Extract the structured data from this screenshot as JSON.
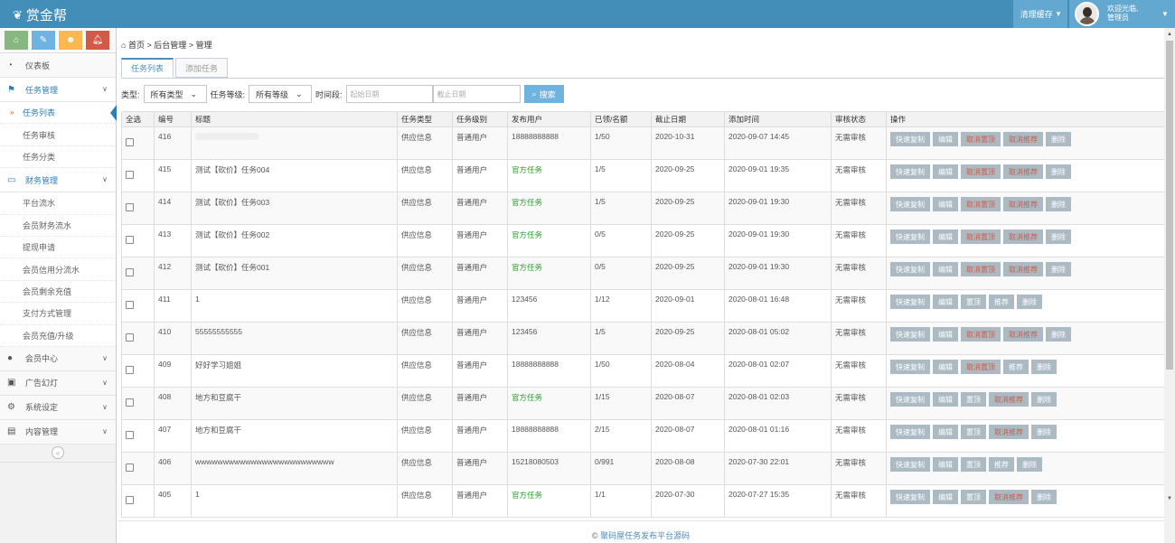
{
  "brand": {
    "name": "赏金帮",
    "icon": "leaf-icon"
  },
  "header": {
    "clear_cache": "清理缓存",
    "welcome_line1": "欢迎光临,",
    "welcome_line2": "管理员"
  },
  "shortcuts": [
    {
      "icon": "home-icon",
      "color": "#87b87f"
    },
    {
      "icon": "pencil-icon",
      "color": "#6fb3e0"
    },
    {
      "icon": "users-icon",
      "color": "#ffb752"
    },
    {
      "icon": "bell-icon",
      "color": "#d15b47"
    }
  ],
  "sidebar": {
    "dashboard": "仪表板",
    "task_mgmt": "任务管理",
    "task_list": "任务列表",
    "task_review": "任务审核",
    "task_category": "任务分类",
    "finance_mgmt": "财务管理",
    "platform_flow": "平台流水",
    "member_finance": "会员财务流水",
    "withdraw": "提现申请",
    "credit_flow": "会员信用分流水",
    "balance_recharge": "会员剩余充值",
    "payment_mgmt": "支付方式管理",
    "member_upgrade": "会员充值/升级",
    "member_center": "会员中心",
    "ads": "广告幻灯",
    "settings": "系统设定",
    "content_mgmt": "内容管理"
  },
  "breadcrumb": {
    "home": "首页",
    "sep1": ">",
    "backend": "后台管理",
    "sep2": ">",
    "current": "管理"
  },
  "tabs": {
    "list": "任务列表",
    "add": "添加任务"
  },
  "filter": {
    "type_label": "类型:",
    "type_value": "所有类型",
    "level_label": "任务等级:",
    "level_value": "所有等级",
    "period_label": "时间段:",
    "start_placeholder": "起始日期",
    "end_placeholder": "截止日期",
    "search": "搜索"
  },
  "table": {
    "headers": [
      "全选",
      "编号",
      "标题",
      "任务类型",
      "任务级别",
      "发布用户",
      "已领/名额",
      "截止日期",
      "添加时间",
      "审核状态",
      "操作"
    ],
    "rows": [
      {
        "id": "416",
        "title": "",
        "type": "供应信息",
        "level": "普通用户",
        "user": "18888888888",
        "green": false,
        "quota": "1/50",
        "deadline": "2020-10-31",
        "added": "2020-09-07 14:45",
        "status": "无需审核",
        "ops": [
          "快速复制",
          "编辑",
          "取消置顶",
          "取消推荐",
          "删除"
        ]
      },
      {
        "id": "415",
        "title": "测试【砍价】任务004",
        "type": "供应信息",
        "level": "普通用户",
        "user": "官方任务",
        "green": true,
        "quota": "1/5",
        "deadline": "2020-09-25",
        "added": "2020-09-01 19:35",
        "status": "无需审核",
        "ops": [
          "快速复制",
          "编辑",
          "取消置顶",
          "取消推荐",
          "删除"
        ]
      },
      {
        "id": "414",
        "title": "测试【砍价】任务003",
        "type": "供应信息",
        "level": "普通用户",
        "user": "官方任务",
        "green": true,
        "quota": "1/5",
        "deadline": "2020-09-25",
        "added": "2020-09-01 19:30",
        "status": "无需审核",
        "ops": [
          "快速复制",
          "编辑",
          "取消置顶",
          "取消推荐",
          "删除"
        ]
      },
      {
        "id": "413",
        "title": "测试【砍价】任务002",
        "type": "供应信息",
        "level": "普通用户",
        "user": "官方任务",
        "green": true,
        "quota": "0/5",
        "deadline": "2020-09-25",
        "added": "2020-09-01 19:30",
        "status": "无需审核",
        "ops": [
          "快速复制",
          "编辑",
          "取消置顶",
          "取消推荐",
          "删除"
        ]
      },
      {
        "id": "412",
        "title": "测试【砍价】任务001",
        "type": "供应信息",
        "level": "普通用户",
        "user": "官方任务",
        "green": true,
        "quota": "0/5",
        "deadline": "2020-09-25",
        "added": "2020-09-01 19:30",
        "status": "无需审核",
        "ops": [
          "快速复制",
          "编辑",
          "取消置顶",
          "取消推荐",
          "删除"
        ]
      },
      {
        "id": "411",
        "title": "1",
        "type": "供应信息",
        "level": "普通用户",
        "user": "123456",
        "green": false,
        "quota": "1/12",
        "deadline": "2020-09-01",
        "added": "2020-08-01 16:48",
        "status": "无需审核",
        "ops": [
          "快速复制",
          "编辑",
          "置顶",
          "推荐",
          "删除"
        ]
      },
      {
        "id": "410",
        "title": "55555555555",
        "type": "供应信息",
        "level": "普通用户",
        "user": "123456",
        "green": false,
        "quota": "1/5",
        "deadline": "2020-09-25",
        "added": "2020-08-01 05:02",
        "status": "无需审核",
        "ops": [
          "快速复制",
          "编辑",
          "取消置顶",
          "取消推荐",
          "删除"
        ]
      },
      {
        "id": "409",
        "title": "好好学习姐姐",
        "type": "供应信息",
        "level": "普通用户",
        "user": "18888888888",
        "green": false,
        "quota": "1/50",
        "deadline": "2020-08-04",
        "added": "2020-08-01 02:07",
        "status": "无需审核",
        "ops": [
          "快速复制",
          "编辑",
          "取消置顶",
          "推荐",
          "删除"
        ]
      },
      {
        "id": "408",
        "title": "地方和豆腐干",
        "type": "供应信息",
        "level": "普通用户",
        "user": "官方任务",
        "green": true,
        "quota": "1/15",
        "deadline": "2020-08-07",
        "added": "2020-08-01 02:03",
        "status": "无需审核",
        "ops": [
          "快速复制",
          "编辑",
          "置顶",
          "取消推荐",
          "删除"
        ]
      },
      {
        "id": "407",
        "title": "地方和豆腐干",
        "type": "供应信息",
        "level": "普通用户",
        "user": "18888888888",
        "green": false,
        "quota": "2/15",
        "deadline": "2020-08-07",
        "added": "2020-08-01 01:16",
        "status": "无需审核",
        "ops": [
          "快速复制",
          "编辑",
          "置顶",
          "取消推荐",
          "删除"
        ]
      },
      {
        "id": "406",
        "title": "wwwwwwwwwwwwwwwwwwwwwwwww",
        "type": "供应信息",
        "level": "普通用户",
        "user": "15218080503",
        "green": false,
        "quota": "0/991",
        "deadline": "2020-08-08",
        "added": "2020-07-30 22:01",
        "status": "无需审核",
        "ops": [
          "快速复制",
          "编辑",
          "置顶",
          "推荐",
          "删除"
        ]
      },
      {
        "id": "405",
        "title": "1",
        "type": "供应信息",
        "level": "普通用户",
        "user": "官方任务",
        "green": true,
        "quota": "1/1",
        "deadline": "2020-07-30",
        "added": "2020-07-27 15:35",
        "status": "无需审核",
        "ops": [
          "快速复制",
          "编辑",
          "置顶",
          "取消推荐",
          "删除"
        ]
      }
    ]
  },
  "footer": {
    "copyright": "©",
    "link": "聚码屋任务发布平台源码"
  },
  "colors": {
    "topbar": "#438eb9",
    "accent": "#2b7dbc",
    "button_grey": "#abbac3",
    "red_text": "#d15b47",
    "green_text": "#2b9a2b"
  }
}
